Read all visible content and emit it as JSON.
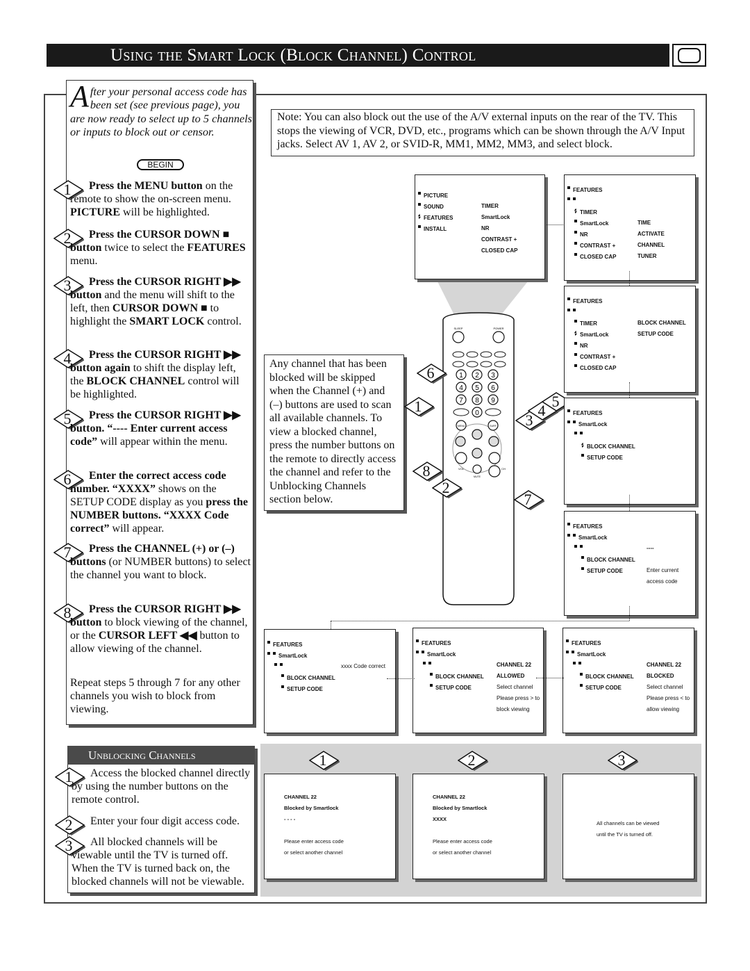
{
  "title": "Using the Smart Lock (Block Channel) Control",
  "intro": {
    "dropcap": "A",
    "text": "fter your personal access code has been set (see previous page), you are now ready to select up to 5 channels or inputs to block out or censor.",
    "begin": "BEGIN"
  },
  "steps": [
    {
      "num": "1",
      "parts": [
        {
          "t": "Press the MENU button",
          "b": true
        },
        {
          "t": " on the remote to show the on-screen menu. "
        },
        {
          "t": "PICTURE",
          "b": true
        },
        {
          "t": " will be highlighted."
        }
      ]
    },
    {
      "num": "2",
      "parts": [
        {
          "t": "Press the CURSOR DOWN ■ button",
          "b": true
        },
        {
          "t": " twice to select the "
        },
        {
          "t": "FEATURES",
          "b": true
        },
        {
          "t": " menu."
        }
      ]
    },
    {
      "num": "3",
      "parts": [
        {
          "t": "Press the CURSOR RIGHT ▶▶ button",
          "b": true
        },
        {
          "t": " and the menu will shift to the left, then "
        },
        {
          "t": "CURSOR DOWN ■",
          "b": true
        },
        {
          "t": " to highlight the "
        },
        {
          "t": "SMART LOCK",
          "b": true
        },
        {
          "t": " control."
        }
      ]
    },
    {
      "num": "4",
      "parts": [
        {
          "t": "Press the CURSOR RIGHT ▶▶ button again",
          "b": true
        },
        {
          "t": " to shift the display left, the "
        },
        {
          "t": "BLOCK CHANNEL",
          "b": true
        },
        {
          "t": " control will be highlighted."
        }
      ]
    },
    {
      "num": "5",
      "parts": [
        {
          "t": "Press the CURSOR RIGHT ▶▶ button. “---- Enter current access code”",
          "b": true
        },
        {
          "t": " will appear within the menu."
        }
      ]
    },
    {
      "num": "6",
      "parts": [
        {
          "t": "Enter the correct access code number. “XXXX”",
          "b": true
        },
        {
          "t": " shows on the SETUP CODE display as you "
        },
        {
          "t": "press the NUMBER buttons. “XXXX Code correct”",
          "b": true
        },
        {
          "t": " will appear."
        }
      ]
    },
    {
      "num": "7",
      "parts": [
        {
          "t": "Press the CHANNEL (+) or (–) buttons",
          "b": true
        },
        {
          "t": " (or NUMBER buttons) to select the channel you want to block."
        }
      ]
    },
    {
      "num": "8",
      "parts": [
        {
          "t": "Press the CURSOR RIGHT ▶▶ button",
          "b": true
        },
        {
          "t": " to block viewing of the channel, or the "
        },
        {
          "t": "CURSOR LEFT ◀◀",
          "b": true
        },
        {
          "t": " button to allow viewing of the channel."
        }
      ]
    }
  ],
  "repeat": "Repeat steps 5 through 7 for any other channels you wish to block from viewing.",
  "note": "Note: You can also block out the use of the A/V external inputs on the rear of the TV. This stops the viewing of VCR, DVD, etc., programs which can be shown through the A/V Input jacks. Select AV 1, AV 2, or SVID-R, MM1, MM2, MM3, and select block.",
  "channel_note": "Any channel that has been blocked will be skipped when the Channel (+) and (–) buttons are used to scan all available channels. To view a blocked channel, press the number buttons on the remote to directly access the channel and refer to the Unblocking Channels section below.",
  "remote": {
    "labels": {
      "sleep": "SLEEP",
      "power": "POWER",
      "menu": "MENU",
      "surf": "SURF",
      "vol": "VOL",
      "ch": "CH",
      "mute": "MUTE"
    },
    "digits": [
      "1",
      "2",
      "3",
      "4",
      "5",
      "6",
      "7",
      "8",
      "9",
      "0"
    ],
    "callouts": [
      "6",
      "1",
      "3",
      "4",
      "5",
      "8",
      "2",
      "7"
    ]
  },
  "screens": [
    {
      "rows": [
        {
          "l": "PICTURE",
          "b": "sq",
          "d": 0
        },
        {
          "l": "SOUND",
          "r": "TIMER",
          "b": "sq",
          "d": 0
        },
        {
          "l": "FEATURES",
          "r": "SmartLock",
          "b": "sel",
          "d": 0
        },
        {
          "l": "INSTALL",
          "r": "NR",
          "b": "sq",
          "d": 0
        },
        {
          "r": "CONTRAST +"
        },
        {
          "r": "CLOSED CAP"
        }
      ]
    },
    {
      "rows": [
        {
          "l": "FEATURES",
          "b": "sq",
          "d": 0
        },
        {
          "b": "sq2",
          "d": 0
        },
        {
          "l": "TIMER",
          "b": "sel",
          "d": 1
        },
        {
          "l": "SmartLock",
          "r": "TIME",
          "b": "sq",
          "d": 1
        },
        {
          "l": "NR",
          "r": "ACTIVATE",
          "b": "sq",
          "d": 1
        },
        {
          "l": "CONTRAST +",
          "r": "CHANNEL",
          "b": "sq",
          "d": 1
        },
        {
          "l": "CLOSED CAP",
          "r": "TUNER",
          "b": "sq",
          "d": 1
        }
      ]
    },
    {
      "rows": [
        {
          "l": "FEATURES",
          "b": "sq",
          "d": 0
        },
        {
          "b": "sq2",
          "d": 0
        },
        {
          "l": "TIMER",
          "r": "BLOCK CHANNEL",
          "b": "sq",
          "d": 1
        },
        {
          "l": "SmartLock",
          "r": "SETUP CODE",
          "b": "sel",
          "d": 1
        },
        {
          "l": "NR",
          "b": "sq",
          "d": 1
        },
        {
          "l": "CONTRAST +",
          "b": "sq",
          "d": 1
        },
        {
          "l": "CLOSED CAP",
          "b": "sq",
          "d": 1
        }
      ]
    },
    {
      "rows": [
        {
          "l": "FEATURES",
          "b": "sq",
          "d": 0
        },
        {
          "l": "SmartLock",
          "b": "sq2",
          "d": 0
        },
        {
          "b": "sq2",
          "d": 1
        },
        {
          "l": "BLOCK CHANNEL",
          "b": "sel",
          "d": 2
        },
        {
          "l": "SETUP CODE",
          "b": "sq",
          "d": 2
        }
      ]
    },
    {
      "rows": [
        {
          "l": "FEATURES",
          "b": "sq",
          "d": 0
        },
        {
          "l": "SmartLock",
          "b": "sq2",
          "d": 0
        },
        {
          "r": "----",
          "b": "sq2",
          "d": 1
        },
        {
          "l": "BLOCK CHANNEL",
          "b": "sq",
          "d": 2
        },
        {
          "l": "SETUP CODE",
          "r": "Enter current",
          "b": "sq",
          "d": 2
        },
        {
          "r": "access code"
        }
      ]
    },
    {
      "rows": [
        {
          "l": "FEATURES",
          "b": "sq",
          "d": 0
        },
        {
          "l": "SmartLock",
          "b": "sq2",
          "d": 0
        },
        {
          "r": "xxxx Code correct",
          "b": "sq2",
          "d": 1
        },
        {
          "l": "BLOCK CHANNEL",
          "b": "sq",
          "d": 2
        },
        {
          "l": "SETUP CODE",
          "b": "sq",
          "d": 2
        }
      ]
    },
    {
      "rows": [
        {
          "l": "FEATURES",
          "b": "sq",
          "d": 0
        },
        {
          "l": "SmartLock",
          "b": "sq2",
          "d": 0
        },
        {
          "r": "CHANNEL 22",
          "b": "sq2",
          "d": 1
        },
        {
          "l": "BLOCK CHANNEL",
          "r": "ALLOWED",
          "b": "sq",
          "d": 2
        },
        {
          "l": "SETUP CODE",
          "r": "Select channel",
          "b": "sq",
          "d": 2
        },
        {
          "r": "Please press > to"
        },
        {
          "r": "block viewing"
        }
      ]
    },
    {
      "rows": [
        {
          "l": "FEATURES",
          "b": "sq",
          "d": 0
        },
        {
          "l": "SmartLock",
          "b": "sq2",
          "d": 0
        },
        {
          "r": "CHANNEL 22",
          "b": "sq2",
          "d": 1
        },
        {
          "l": "BLOCK CHANNEL",
          "r": "BLOCKED",
          "b": "sq",
          "d": 2
        },
        {
          "l": "SETUP CODE",
          "r": "Select channel",
          "b": "sq",
          "d": 2
        },
        {
          "r": "Please press < to"
        },
        {
          "r": "allow viewing"
        }
      ]
    }
  ],
  "unblocking": {
    "heading": "Unblocking Channels",
    "steps": [
      {
        "num": "1",
        "text": "Access the blocked channel directly by using the number buttons on the remote control."
      },
      {
        "num": "2",
        "text": "Enter your four digit access code."
      },
      {
        "num": "3",
        "text": "All blocked channels will be viewable until the TV is turned off. When the TV is turned back on, the blocked channels will not be viewable."
      }
    ],
    "screens": [
      {
        "num": "1",
        "lines": [
          "CHANNEL 22",
          "Blocked by Smartlock",
          "- - - -",
          "Please enter access code",
          "or select another channel"
        ]
      },
      {
        "num": "2",
        "lines": [
          "CHANNEL 22",
          "Blocked by Smartlock",
          "XXXX",
          "Please enter access code",
          "or select another channel"
        ]
      },
      {
        "num": "3",
        "lines": [
          "All channels can be viewed",
          "until the TV is turned off."
        ]
      }
    ]
  }
}
